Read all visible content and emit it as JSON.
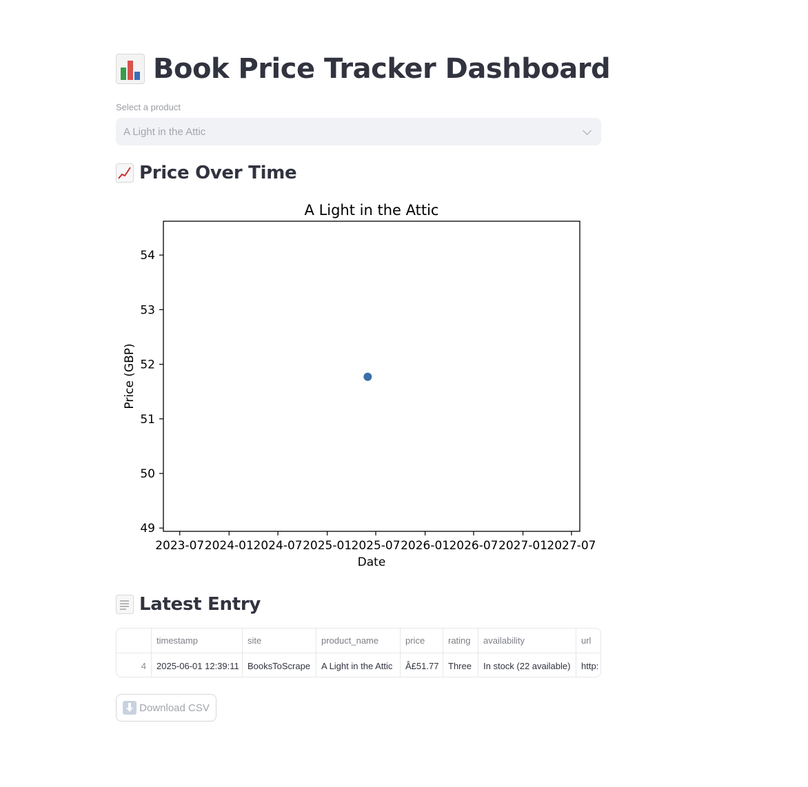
{
  "header": {
    "title": "Book Price Tracker Dashboard",
    "title_icon": "bar-chart-emoji"
  },
  "product_select": {
    "label": "Select a product",
    "selected": "A Light in the Attic"
  },
  "price_section": {
    "heading": "Price Over Time",
    "icon": "chart-increasing-emoji"
  },
  "latest_section": {
    "heading": "Latest Entry",
    "icon": "page-facing-up-emoji"
  },
  "table": {
    "columns": [
      "",
      "timestamp",
      "site",
      "product_name",
      "price",
      "rating",
      "availability",
      "url"
    ],
    "rows": [
      [
        "4",
        "2025-06-01 12:39:11",
        "BooksToScrape",
        "A Light in the Attic",
        "Â£51.77",
        "Three",
        "In stock (22 available)",
        "http:"
      ]
    ]
  },
  "download": {
    "label": "Download CSV",
    "icon": "down-arrow-icon"
  },
  "chart_data": {
    "type": "scatter",
    "title": "A Light in the Attic",
    "xlabel": "Date",
    "ylabel": "Price (GBP)",
    "x_ticks": [
      "2023-07",
      "2024-01",
      "2024-07",
      "2025-01",
      "2025-07",
      "2026-01",
      "2026-07",
      "2027-01",
      "2027-07"
    ],
    "y_ticks": [
      "49",
      "50",
      "51",
      "52",
      "53",
      "54"
    ],
    "ylim": [
      48.94,
      54.62
    ],
    "xlim": [
      "2023-05-01",
      "2027-08-01"
    ],
    "points": [
      {
        "x": "2025-06-01",
        "y": 51.77
      }
    ],
    "marker_color": "#3b6fa8",
    "grid": false
  }
}
